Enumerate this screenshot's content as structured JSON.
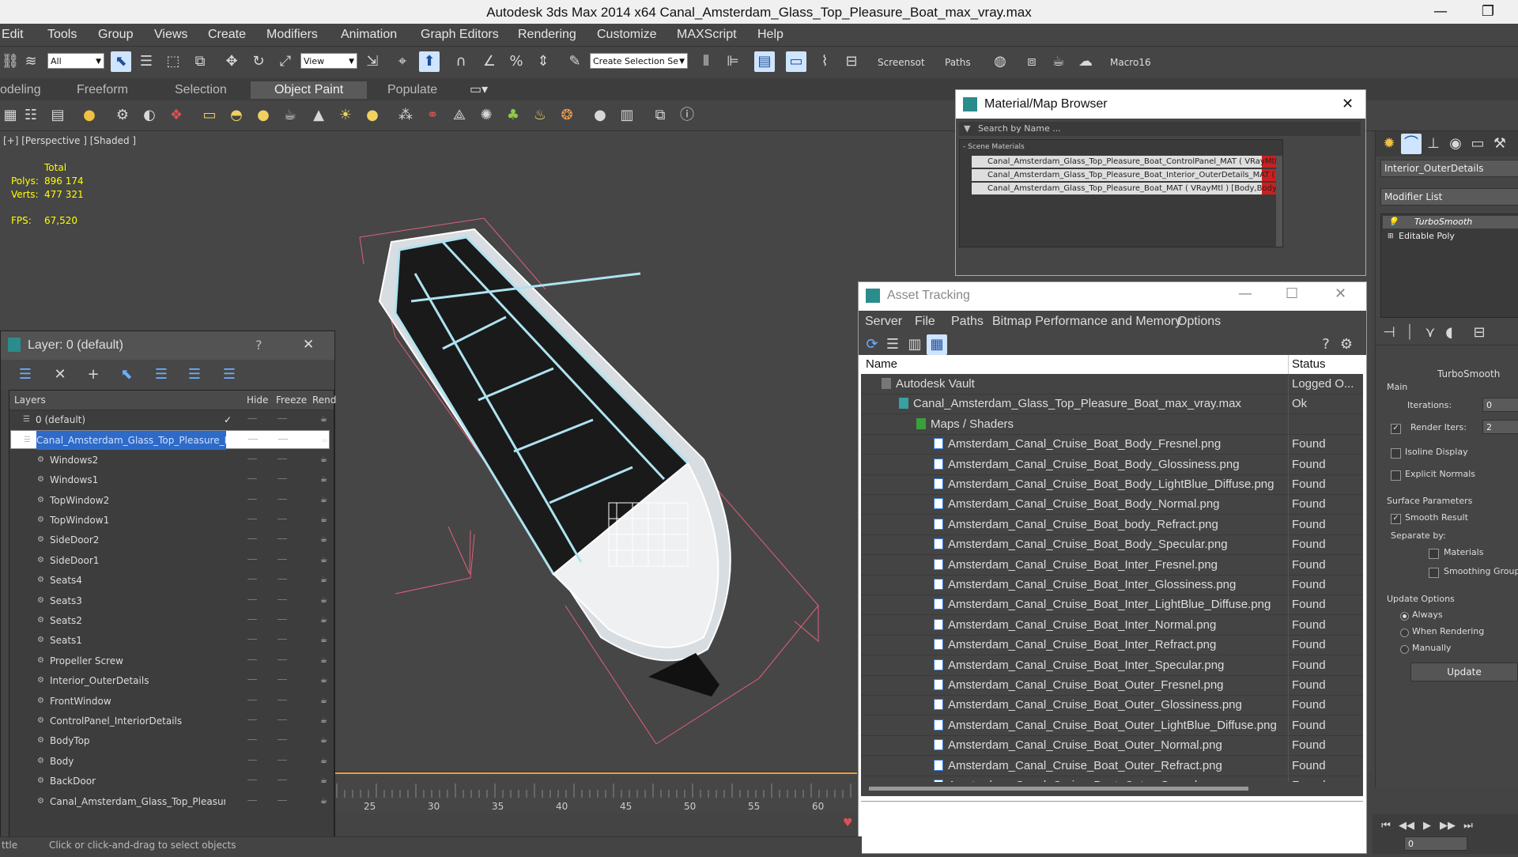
{
  "window": {
    "title": "Autodesk 3ds Max  2014 x64      Canal_Amsterdam_Glass_Top_Pleasure_Boat_max_vray.max",
    "minimize": "—",
    "restore": "❐"
  },
  "menu": [
    "Edit",
    "Tools",
    "Group",
    "Views",
    "Create",
    "Modifiers",
    "Animation",
    "Graph Editors",
    "Rendering",
    "Customize",
    "MAXScript",
    "Help"
  ],
  "toolbar": {
    "filter_value": "All",
    "view_value": "View",
    "selection_set_placeholder": "Create Selection Se",
    "screenshot_label": "Screensot",
    "paths_label": "Paths",
    "macro_label": "Macro16"
  },
  "ribbon_tabs": [
    "odeling",
    "Freeform",
    "Selection",
    "Object Paint",
    "Populate"
  ],
  "viewport": {
    "label": "[+] [Perspective ] [Shaded ]",
    "stats": {
      "total_label": "Total",
      "polys_label": "Polys:",
      "polys": "896 174",
      "verts_label": "Verts:",
      "verts": "477 321",
      "fps_label": "FPS:",
      "fps": "67,520"
    }
  },
  "layer_panel": {
    "title": "Layer: 0 (default)",
    "help": "?",
    "close": "✕",
    "col_layers": "Layers",
    "col_hide": "Hide",
    "col_freeze": "Freeze",
    "col_render": "Rend",
    "rows": [
      {
        "name": "0 (default)",
        "indent": 0
      },
      {
        "name": "Canal_Amsterdam_Glass_Top_Pleasure_Boat",
        "indent": 0,
        "selected": true
      },
      {
        "name": "Windows2",
        "indent": 1
      },
      {
        "name": "Windows1",
        "indent": 1
      },
      {
        "name": "TopWindow2",
        "indent": 1
      },
      {
        "name": "TopWindow1",
        "indent": 1
      },
      {
        "name": "SideDoor2",
        "indent": 1
      },
      {
        "name": "SideDoor1",
        "indent": 1
      },
      {
        "name": "Seats4",
        "indent": 1
      },
      {
        "name": "Seats3",
        "indent": 1
      },
      {
        "name": "Seats2",
        "indent": 1
      },
      {
        "name": "Seats1",
        "indent": 1
      },
      {
        "name": "Propeller Screw",
        "indent": 1
      },
      {
        "name": "Interior_OuterDetails",
        "indent": 1
      },
      {
        "name": "FrontWindow",
        "indent": 1
      },
      {
        "name": "ControlPanel_InteriorDetails",
        "indent": 1
      },
      {
        "name": "BodyTop",
        "indent": 1
      },
      {
        "name": "Body",
        "indent": 1
      },
      {
        "name": "BackDoor",
        "indent": 1
      },
      {
        "name": "Canal_Amsterdam_Glass_Top_Pleasure_Boat",
        "indent": 1
      }
    ]
  },
  "material_browser": {
    "title": "Material/Map Browser",
    "search_placeholder": "Search by Name ...",
    "section": "- Scene Materials",
    "items": [
      "Canal_Amsterdam_Glass_Top_Pleasure_Boat_ControlPanel_MAT ( VRayMtl ) [Cont...",
      "Canal_Amsterdam_Glass_Top_Pleasure_Boat_Interior_OuterDetails_MAT ( VRayMtl...",
      "Canal_Amsterdam_Glass_Top_Pleasure_Boat_MAT ( VRayMtl ) [Body,BodyTop,Pr..."
    ]
  },
  "asset_tracking": {
    "title": "Asset Tracking",
    "menu": [
      "Server",
      "File",
      "Paths",
      "Bitmap Performance and Memory",
      "Options"
    ],
    "col_name": "Name",
    "col_status": "Status",
    "rows": [
      {
        "name": "Autodesk Vault",
        "status": "Logged O...",
        "level": 0
      },
      {
        "name": "Canal_Amsterdam_Glass_Top_Pleasure_Boat_max_vray.max",
        "status": "Ok",
        "level": 1
      },
      {
        "name": "Maps / Shaders",
        "status": "",
        "level": 2
      },
      {
        "name": "Amsterdam_Canal_Cruise_Boat_Body_Fresnel.png",
        "status": "Found",
        "level": 3
      },
      {
        "name": "Amsterdam_Canal_Cruise_Boat_Body_Glossiness.png",
        "status": "Found",
        "level": 3
      },
      {
        "name": "Amsterdam_Canal_Cruise_Boat_Body_LightBlue_Diffuse.png",
        "status": "Found",
        "level": 3
      },
      {
        "name": "Amsterdam_Canal_Cruise_Boat_Body_Normal.png",
        "status": "Found",
        "level": 3
      },
      {
        "name": "Amsterdam_Canal_Cruise_Boat_body_Refract.png",
        "status": "Found",
        "level": 3
      },
      {
        "name": "Amsterdam_Canal_Cruise_Boat_Body_Specular.png",
        "status": "Found",
        "level": 3
      },
      {
        "name": "Amsterdam_Canal_Cruise_Boat_Inter_Fresnel.png",
        "status": "Found",
        "level": 3
      },
      {
        "name": "Amsterdam_Canal_Cruise_Boat_Inter_Glossiness.png",
        "status": "Found",
        "level": 3
      },
      {
        "name": "Amsterdam_Canal_Cruise_Boat_Inter_LightBlue_Diffuse.png",
        "status": "Found",
        "level": 3
      },
      {
        "name": "Amsterdam_Canal_Cruise_Boat_Inter_Normal.png",
        "status": "Found",
        "level": 3
      },
      {
        "name": "Amsterdam_Canal_Cruise_Boat_Inter_Refract.png",
        "status": "Found",
        "level": 3
      },
      {
        "name": "Amsterdam_Canal_Cruise_Boat_Inter_Specular.png",
        "status": "Found",
        "level": 3
      },
      {
        "name": "Amsterdam_Canal_Cruise_Boat_Outer_Fresnel.png",
        "status": "Found",
        "level": 3
      },
      {
        "name": "Amsterdam_Canal_Cruise_Boat_Outer_Glossiness.png",
        "status": "Found",
        "level": 3
      },
      {
        "name": "Amsterdam_Canal_Cruise_Boat_Outer_LightBlue_Diffuse.png",
        "status": "Found",
        "level": 3
      },
      {
        "name": "Amsterdam_Canal_Cruise_Boat_Outer_Normal.png",
        "status": "Found",
        "level": 3
      },
      {
        "name": "Amsterdam_Canal_Cruise_Boat_Outer_Refract.png",
        "status": "Found",
        "level": 3
      },
      {
        "name": "Amsterdam_Canal_Cruise_Boat_Outer_Specular.png",
        "status": "Found",
        "level": 3
      }
    ]
  },
  "command_panel": {
    "object_name": "Interior_OuterDetails",
    "modifier_list": "Modifier List",
    "stack": [
      "TurboSmooth",
      "Editable Poly"
    ],
    "rollout_title": "TurboSmooth",
    "main_label": "Main",
    "iterations_label": "Iterations:",
    "iterations_value": "0",
    "render_iters_label": "Render Iters:",
    "render_iters_value": "2",
    "isoline_label": "Isoline Display",
    "explicit_normals_label": "Explicit Normals",
    "surface_params_label": "Surface Parameters",
    "smooth_result_label": "Smooth Result",
    "separate_by_label": "Separate by:",
    "materials_label": "Materials",
    "smoothing_groups_label": "Smoothing Groups",
    "update_options_label": "Update Options",
    "always_label": "Always",
    "when_rendering_label": "When Rendering",
    "manually_label": "Manually",
    "update_button": "Update",
    "frame_value": "0"
  },
  "timeline": {
    "ticks": [
      "25",
      "30",
      "35",
      "40",
      "45",
      "50",
      "55",
      "60"
    ]
  },
  "statusbar": {
    "left": "ttle",
    "hint": "Click or click-and-drag to select objects"
  },
  "colors": {
    "selection_blue": "#2e6ac8",
    "material_red": "#cc1f1f",
    "trajectory_pink": "#e0607a"
  }
}
